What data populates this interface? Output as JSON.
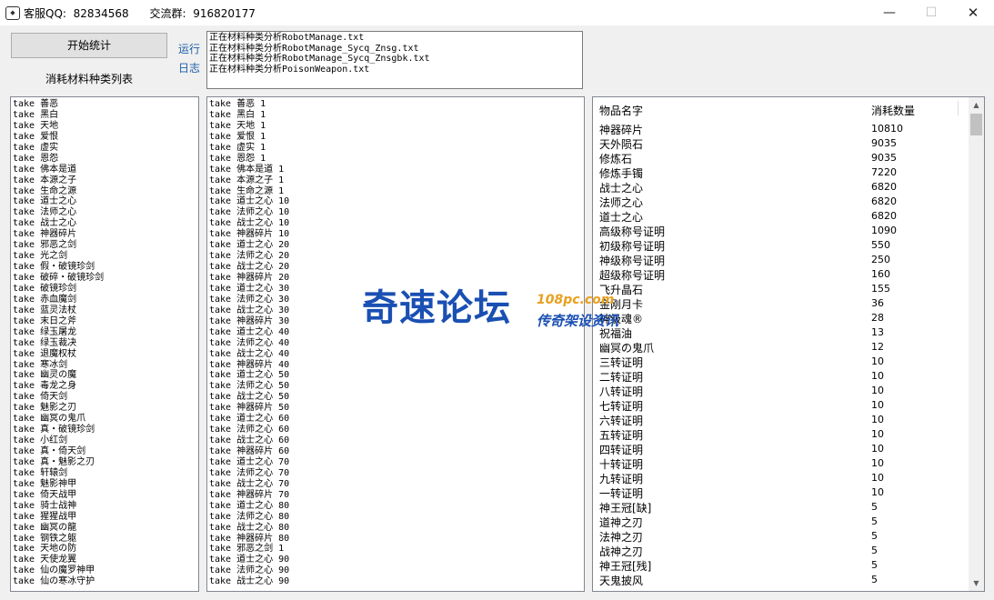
{
  "window": {
    "title": "客服QQ:  82834568      交流群:  916820177",
    "icon": "app-icon",
    "minimize": "—",
    "maximize": "☐",
    "close": "✕"
  },
  "controls": {
    "start_button": "开始统计",
    "caption": "消耗材料种类列表",
    "link_run": "运行",
    "link_log": "日志"
  },
  "log_lines": [
    "正在材料种类分析RobotManage.txt",
    "正在材料种类分析RobotManage_Sycq_Znsg.txt",
    "正在材料种类分析RobotManage_Sycq_Znsgbk.txt",
    "正在材料种类分析PoisonWeapon.txt"
  ],
  "left_list": [
    "take 善恶",
    "take 黑白",
    "take 天地",
    "take 爱恨",
    "take 虚实",
    "take 恩怨",
    "take 佛本是道",
    "take 本源之子",
    "take 生命之源",
    "take 道士之心",
    "take 法师之心",
    "take 战士之心",
    "take 神器碎片",
    "take 邪恶之剑",
    "take 光之剑",
    "take 假・破镜珍剑",
    "take 破碎・破镜珍剑",
    "take 破镜珍剑",
    "take 赤血魔剑",
    "take 蓝灵法杖",
    "take 末日之斧",
    "take 绿玉屠龙",
    "take 绿玉裁决",
    "take 退魔权杖",
    "take 寒冰剑",
    "take 幽灵の魔",
    "take 毒龙之身",
    "take 倚天剑",
    "take 魅影之刃",
    "take 幽冥の鬼爪",
    "take 真・破镜珍剑",
    "take 小红剑",
    "take 真・倚天剑",
    "take 真・魅影之刃",
    "take 轩辕剑",
    "take 魅影神甲",
    "take 倚天战甲",
    "take 骑士战神",
    "take 猩猩战甲",
    "take 幽冥の龍",
    "take 钢铁之躯",
    "take 天地の防",
    "take 天使龙翼",
    "take 仙の魔罗神甲",
    "take 仙の寒冰守护"
  ],
  "mid_list": [
    "take 善恶 1",
    "take 黑白 1",
    "take 天地 1",
    "take 爱恨 1",
    "take 虚实 1",
    "take 恩怨 1",
    "take 佛本是道 1",
    "take 本源之子 1",
    "take 生命之源 1",
    "take 道士之心 10",
    "take 法师之心 10",
    "take 战士之心 10",
    "take 神器碎片 10",
    "take 道士之心 20",
    "take 法师之心 20",
    "take 战士之心 20",
    "take 神器碎片 20",
    "take 道士之心 30",
    "take 法师之心 30",
    "take 战士之心 30",
    "take 神器碎片 30",
    "take 道士之心 40",
    "take 法师之心 40",
    "take 战士之心 40",
    "take 神器碎片 40",
    "take 道士之心 50",
    "take 法师之心 50",
    "take 战士之心 50",
    "take 神器碎片 50",
    "take 道士之心 60",
    "take 法师之心 60",
    "take 战士之心 60",
    "take 神器碎片 60",
    "take 道士之心 70",
    "take 法师之心 70",
    "take 战士之心 70",
    "take 神器碎片 70",
    "take 道士之心 80",
    "take 法师之心 80",
    "take 战士之心 80",
    "take 神器碎片 80",
    "take 邪恶之剑 1",
    "take 道士之心 90",
    "take 法师之心 90",
    "take 战士之心 90"
  ],
  "grid": {
    "headers": [
      "物品名字",
      "消耗数量"
    ],
    "rows": [
      [
        "神器碎片",
        "10810"
      ],
      [
        "天外陨石",
        "9035"
      ],
      [
        "修炼石",
        "9035"
      ],
      [
        "修炼手镯",
        "7220"
      ],
      [
        "战士之心",
        "6820"
      ],
      [
        "法师之心",
        "6820"
      ],
      [
        "道士之心",
        "6820"
      ],
      [
        "高级称号证明",
        "1090"
      ],
      [
        "初级称号证明",
        "550"
      ],
      [
        "神级称号证明",
        "250"
      ],
      [
        "超级称号证明",
        "160"
      ],
      [
        "飞升晶石",
        "155"
      ],
      [
        "金刚月卡",
        "36"
      ],
      [
        "神级魂®",
        "28"
      ],
      [
        "祝福油",
        "13"
      ],
      [
        "幽冥の鬼爪",
        "12"
      ],
      [
        "三转证明",
        "10"
      ],
      [
        "二转证明",
        "10"
      ],
      [
        "八转证明",
        "10"
      ],
      [
        "七转证明",
        "10"
      ],
      [
        "六转证明",
        "10"
      ],
      [
        "五转证明",
        "10"
      ],
      [
        "四转证明",
        "10"
      ],
      [
        "十转证明",
        "10"
      ],
      [
        "九转证明",
        "10"
      ],
      [
        "一转证明",
        "10"
      ],
      [
        "神王冠[缺]",
        "5"
      ],
      [
        "道神之刃",
        "5"
      ],
      [
        "法神之刃",
        "5"
      ],
      [
        "战神之刃",
        "5"
      ],
      [
        "神王冠[残]",
        "5"
      ],
      [
        "天鬼披风",
        "5"
      ]
    ]
  },
  "watermark": {
    "main": "奇速论坛",
    "url": "108pc.com",
    "sub": "传奇架设资讯"
  }
}
